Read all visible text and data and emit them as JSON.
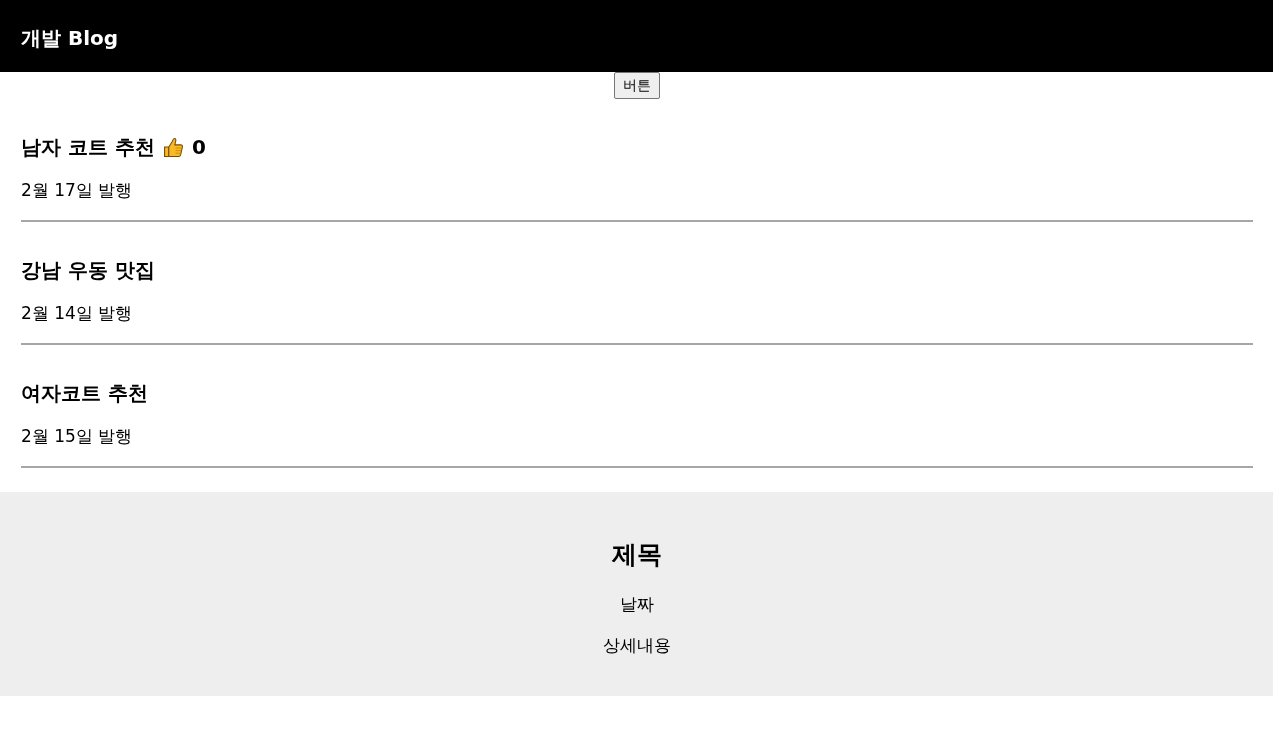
{
  "header": {
    "title": "개발 Blog"
  },
  "button": {
    "label": "버튼"
  },
  "posts": [
    {
      "title": "남자 코트 추천",
      "likes": "0",
      "date": "2월 17일 발행"
    },
    {
      "title": "강남 우동 맛집",
      "date": "2월 14일 발행"
    },
    {
      "title": "여자코트 추천",
      "date": "2월 15일 발행"
    }
  ],
  "modal": {
    "title": "제목",
    "date": "날짜",
    "content": "상세내용"
  }
}
